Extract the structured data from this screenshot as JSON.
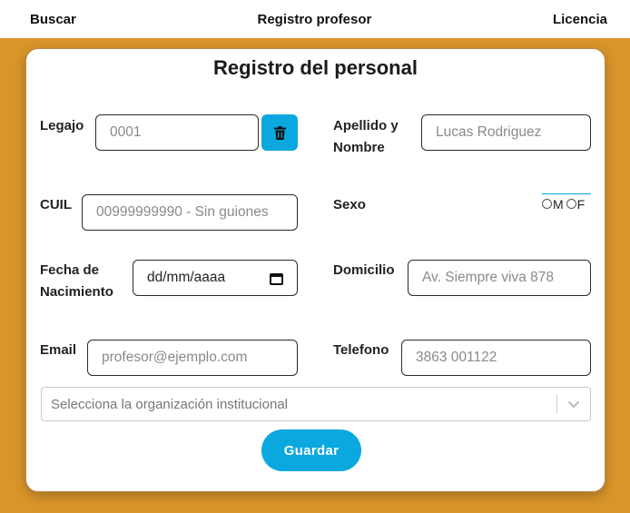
{
  "nav": {
    "search": "Buscar",
    "register": "Registro profesor",
    "license": "Licencia"
  },
  "form": {
    "title": "Registro del personal",
    "legajo": {
      "label": "Legajo",
      "placeholder": "0001"
    },
    "apellido": {
      "label_line1": "Apellido y",
      "label_line2": "Nombre",
      "placeholder": "Lucas Rodriguez"
    },
    "cuil": {
      "label": "CUIL",
      "placeholder": "00999999990 - Sin guiones"
    },
    "sexo": {
      "label": "Sexo",
      "option_m": "M",
      "option_f": "F"
    },
    "fecha": {
      "label_line1": "Fecha de",
      "label_line2": "Nacimiento",
      "value": "dd/mm/aaaa"
    },
    "domicilio": {
      "label": "Domicilio",
      "placeholder": "Av. Siempre viva 878"
    },
    "email": {
      "label": "Email",
      "placeholder": "profesor@ejemplo.com"
    },
    "telefono": {
      "label": "Telefono",
      "placeholder": "3863 001122"
    },
    "organizacion": {
      "placeholder": "Selecciona la organización institucional"
    },
    "save_label": "Guardar"
  },
  "icons": {
    "delete": "trash-icon",
    "calendar": "calendar-icon",
    "dropdown": "chevron-down-icon"
  },
  "colors": {
    "background": "#d9952a",
    "accent": "#0aa8df"
  }
}
